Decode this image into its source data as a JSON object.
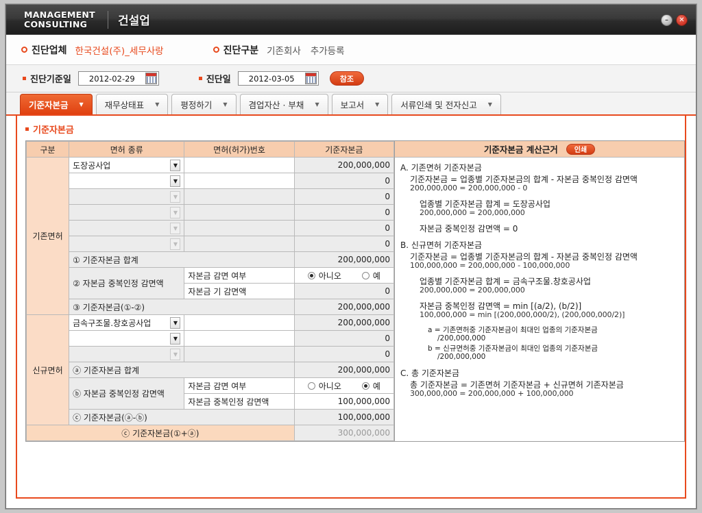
{
  "window": {
    "brand_line1": "MANAGEMENT",
    "brand_line2": "CONSULTING",
    "app_title": "건설업",
    "minimize_label": "–",
    "close_label": "✕"
  },
  "info": {
    "company_label": "진단업체",
    "company_value": "한국건설(주)_세무사랑",
    "type_label": "진단구분",
    "type_value": "기존회사",
    "type_extra": "추가등록"
  },
  "dates": {
    "base_label": "진단기준일",
    "base_value": "2012-02-29",
    "diag_label": "진단일",
    "diag_value": "2012-03-05",
    "refer_button": "참조"
  },
  "tabs": [
    {
      "label": "기준자본금",
      "active": true
    },
    {
      "label": "재무상태표",
      "active": false
    },
    {
      "label": "평정하기",
      "active": false
    },
    {
      "label": "겸업자산 · 부채",
      "active": false
    },
    {
      "label": "보고서",
      "active": false
    },
    {
      "label": "서류인쇄 및 전자신고",
      "active": false
    }
  ],
  "section": {
    "title": "기준자본금"
  },
  "table": {
    "headers": [
      "구분",
      "면허 종류",
      "면허(허가)번호",
      "기준자본금"
    ],
    "calc_header": "기준자본금 계산근거",
    "print_button": "인쇄",
    "existing_group_label": "기존면허",
    "new_group_label": "신규면허",
    "existing_rows": [
      {
        "license": "도장공사업",
        "number": "",
        "amount": "200,000,000",
        "enabled": true
      },
      {
        "license": "",
        "number": "",
        "amount": "0",
        "enabled": true
      },
      {
        "license": "",
        "number": "",
        "amount": "0",
        "enabled": false
      },
      {
        "license": "",
        "number": "",
        "amount": "0",
        "enabled": false
      },
      {
        "license": "",
        "number": "",
        "amount": "0",
        "enabled": false
      },
      {
        "license": "",
        "number": "",
        "amount": "0",
        "enabled": false
      }
    ],
    "existing_sum_label": "① 기준자본금 합계",
    "existing_sum_value": "200,000,000",
    "existing_ded_label": "② 자본금 중복인정 감면액",
    "existing_ded_q_label": "자본금 감면 여부",
    "existing_ded_no": "아니오",
    "existing_ded_yes": "예",
    "existing_ded_selected": "no",
    "existing_ded_amt_label": "자본금 기 감면액",
    "existing_ded_amt_value": "0",
    "existing_total_label": "③ 기준자본금(①-②)",
    "existing_total_value": "200,000,000",
    "new_rows": [
      {
        "license": "금속구조물.창호공사업",
        "number": "",
        "amount": "200,000,000",
        "enabled": true
      },
      {
        "license": "",
        "number": "",
        "amount": "0",
        "enabled": true
      },
      {
        "license": "",
        "number": "",
        "amount": "0",
        "enabled": false
      }
    ],
    "new_sum_label": "ⓐ 기준자본금 합계",
    "new_sum_value": "200,000,000",
    "new_ded_label": "ⓑ 자본금 중복인정 감면액",
    "new_ded_q_label": "자본금 감면 여부",
    "new_ded_no": "아니오",
    "new_ded_yes": "예",
    "new_ded_selected": "yes",
    "new_ded_amt_label": "자본금 중복인정 감면액",
    "new_ded_amt_value": "100,000,000",
    "new_total_label": "ⓒ 기준자본금(ⓐ-ⓑ)",
    "new_total_value": "100,000,000",
    "grand_total_label": "ⓒ 기준자본금(①+ⓐ)",
    "grand_total_value": "300,000,000"
  },
  "calc": {
    "a_title": "A. 기존면허 기준자본금",
    "a_l1": "기준자본금 = 업종별 기준자본금의 합계 - 자본금 중복인정 감면액",
    "a_l2": "200,000,000 = 200,000,000 - 0",
    "a_l3": "업종별 기준자본금 합계 = 도장공사업",
    "a_l4": "200,000,000 = 200,000,000",
    "a_l5": "자본금 중복인정 감면액 = 0",
    "b_title": "B. 신규면허 기준자본금",
    "b_l1": "기준자본금 = 업종별 기준자본금의 합계 - 자본금 중복인정 감면액",
    "b_l2": "100,000,000 = 200,000,000 - 100,000,000",
    "b_l3": "업종별 기준자본금 합계 = 금속구조물.창호공사업",
    "b_l4": "200,000,000 = 200,000,000",
    "b_l5": "자본금 중복인정 감면액 = min  [(a/2), (b/2)]",
    "b_l6": "100,000,000 = min  [(200,000,000/2), (200,000,000/2)]",
    "b_a1": "a = 기존면허중 기준자본금이 최대인 업종의 기준자본금",
    "b_a2": "/200,000,000",
    "b_b1": "b = 신규면허중 기준자본금이 최대인 업종의 기준자본금",
    "b_b2": "/200,000,000",
    "c_title": "C. 총 기준자본금",
    "c_l1": "총 기준자본금 = 기존면허 기준자본금 + 신규면허 기존자본금",
    "c_l2": "300,000,000 = 200,000,000 + 100,000,000"
  },
  "colors": {
    "accent": "#e8491d",
    "header_peach": "#f7cdae",
    "row_peach": "#fbdcc6",
    "readonly_grey": "#ececec"
  }
}
